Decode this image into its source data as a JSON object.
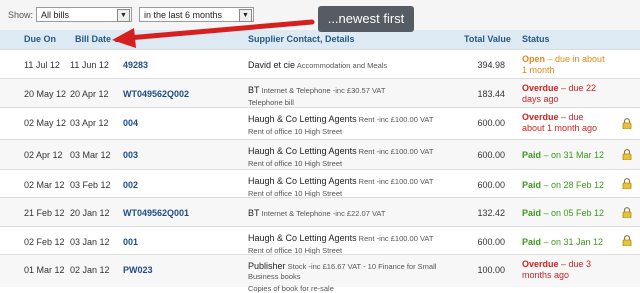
{
  "filter": {
    "show_label": "Show:",
    "bills_select": "All bills",
    "period_select": "in the last 6 months"
  },
  "callout": "...newest first",
  "columns": {
    "due_on": "Due On",
    "bill_date": "Bill Date",
    "supplier": "Supplier Contact, Details",
    "total": "Total Value",
    "status": "Status"
  },
  "rows": [
    {
      "due": "11 Jul 12",
      "bill": "11 Jun 12",
      "ref": "49283",
      "supplier": "David et cie",
      "detail": "Accommodation and Meals",
      "detail2": "",
      "total": "394.98",
      "status_word": "Open",
      "status_rest": " – due in about 1 month",
      "status_type": "open",
      "locked": false
    },
    {
      "due": "20 May 12",
      "bill": "20 Apr 12",
      "ref": "WT049562Q002",
      "supplier": "BT",
      "detail": "Internet & Telephone -inc £30.57 VAT",
      "detail2": "Telephone bill",
      "total": "183.44",
      "status_word": "Overdue",
      "status_rest": " – due 22 days ago",
      "status_type": "overdue",
      "locked": false
    },
    {
      "due": "02 May 12",
      "bill": "03 Apr 12",
      "ref": "004",
      "supplier": "Haugh & Co Letting Agents",
      "detail": "Rent -inc £100.00 VAT",
      "detail2": "Rent of office 10 High Street",
      "total": "600.00",
      "status_word": "Overdue",
      "status_rest": " – due about 1 month ago",
      "status_type": "overdue",
      "locked": true
    },
    {
      "due": "02 Apr 12",
      "bill": "03 Mar 12",
      "ref": "003",
      "supplier": "Haugh & Co Letting Agents",
      "detail": "Rent -inc £100.00 VAT",
      "detail2": "Rent of office 10 High Street",
      "total": "600.00",
      "status_word": "Paid",
      "status_rest": " – on 31 Mar 12",
      "status_type": "paid",
      "locked": true
    },
    {
      "due": "02 Mar 12",
      "bill": "03 Feb 12",
      "ref": "002",
      "supplier": "Haugh & Co Letting Agents",
      "detail": "Rent -inc £100.00 VAT",
      "detail2": "Rent of office 10 High Street",
      "total": "600.00",
      "status_word": "Paid",
      "status_rest": " – on 28 Feb 12",
      "status_type": "paid",
      "locked": true
    },
    {
      "due": "21 Feb 12",
      "bill": "20 Jan 12",
      "ref": "WT049562Q001",
      "supplier": "BT",
      "detail": "Internet & Telephone -inc £22.07 VAT",
      "detail2": "",
      "total": "132.42",
      "status_word": "Paid",
      "status_rest": " – on 05 Feb 12",
      "status_type": "paid",
      "locked": true
    },
    {
      "due": "02 Feb 12",
      "bill": "03 Jan 12",
      "ref": "001",
      "supplier": "Haugh & Co Letting Agents",
      "detail": "Rent -inc £100.00 VAT",
      "detail2": "Rent of office 10 High Street",
      "total": "600.00",
      "status_word": "Paid",
      "status_rest": " – on 31 Jan 12",
      "status_type": "paid",
      "locked": true
    },
    {
      "due": "01 Mar 12",
      "bill": "02 Jan 12",
      "ref": "PW023",
      "supplier": "Publisher",
      "detail": "Stock -inc £16.67 VAT - 10 Finance for Small Business books",
      "detail2": "Copies of book for re-sale",
      "total": "100.00",
      "status_word": "Overdue",
      "status_rest": " – due 3 months ago",
      "status_type": "overdue",
      "locked": false
    }
  ],
  "colors": {
    "header_bg": "#dde9f3",
    "header_text": "#2a5883",
    "arrow": "#d62020",
    "open": "#e2891c",
    "overdue": "#cc2222",
    "paid": "#3d9a1d"
  },
  "icons": {
    "lock": "padlock-icon",
    "sort": "sort-asc-icon"
  }
}
